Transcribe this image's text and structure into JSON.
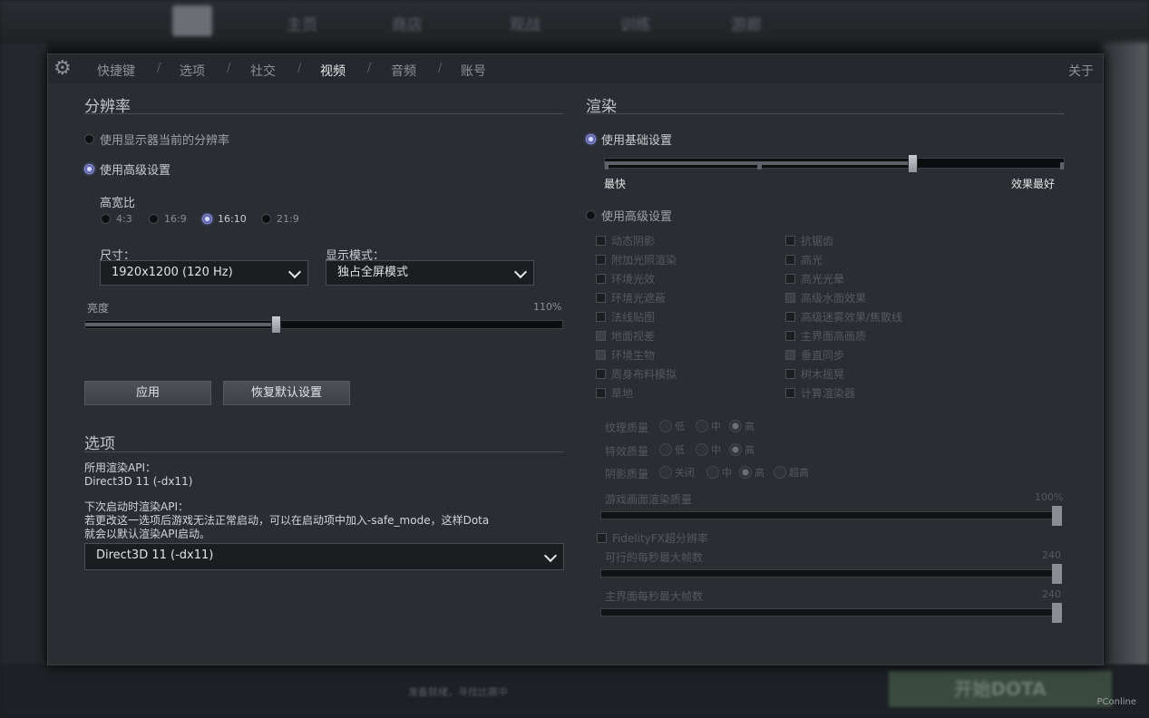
{
  "background": {
    "top_nav": [
      "主页",
      "商店",
      "观战",
      "训练",
      "游廊"
    ],
    "play_button": "开始DOTA",
    "status_text": "准备就绪，寻找比赛中",
    "watermark": "PConline"
  },
  "tabs": {
    "items": [
      "快捷键",
      "选项",
      "社交",
      "视频",
      "音频",
      "账号"
    ],
    "active": "视频",
    "about": "关于"
  },
  "resolution": {
    "title": "分辨率",
    "use_monitor": "使用显示器当前的分辨率",
    "use_advanced": "使用高级设置",
    "aspect_label": "高宽比",
    "aspect_options": [
      "4:3",
      "16:9",
      "16:10",
      "21:9"
    ],
    "aspect_selected": "16:10",
    "size_label": "尺寸：",
    "size_value": "1920x1200 (120 Hz)",
    "display_mode_label": "显示模式：",
    "display_mode_value": "独占全屏模式",
    "brightness_label": "亮度",
    "brightness_value": "110%",
    "brightness_level": 0.4,
    "apply_button": "应用",
    "reset_button": "恢复默认设置"
  },
  "options": {
    "title": "选项",
    "api_label": "所用渲染API：",
    "api_value": "Direct3D 11 (-dx11)",
    "next_api_label": "下次启动时渲染API：",
    "next_api_note_line1": "若更改这一选项后游戏无法正常启动，可以在启动项中加入-safe_mode，这样Dota",
    "next_api_note_line2": "就会以默认渲染API启动。",
    "api_select_value": "Direct3D 11 (-dx11)"
  },
  "render": {
    "title": "渲染",
    "use_basic": "使用基础设置",
    "basic_level": 0.67,
    "fastest": "最快",
    "best": "效果最好",
    "use_advanced": "使用高级设置",
    "checkboxes_left": [
      "动态阴影",
      "附加光照渲染",
      "环境光效",
      "环境光遮蔽",
      "法线贴图",
      "地面视差",
      "环境生物",
      "周身布料模拟",
      "草地"
    ],
    "checkboxes_right": [
      "抗锯齿",
      "高光",
      "高光光晕",
      "高级水面效果",
      "高级迷雾效果/焦散线",
      "主界面高画质",
      "垂直同步",
      "树木摇晃",
      "计算渲染器"
    ],
    "texture_quality_label": "纹理质量",
    "effects_quality_label": "特效质量",
    "shadow_quality_label": "阴影质量",
    "quality_options": [
      "低",
      "中",
      "高"
    ],
    "shadow_options": [
      "关闭",
      "中",
      "高",
      "超高"
    ],
    "render_quality_label": "游戏画面渲染质量",
    "render_quality_value": "100%",
    "fidelityfx": "FidelityFX超分辨率",
    "max_fps_label": "可行的每秒最大帧数",
    "max_fps_value": "240",
    "menu_fps_label": "主界面每秒最大帧数",
    "menu_fps_value": "240"
  }
}
